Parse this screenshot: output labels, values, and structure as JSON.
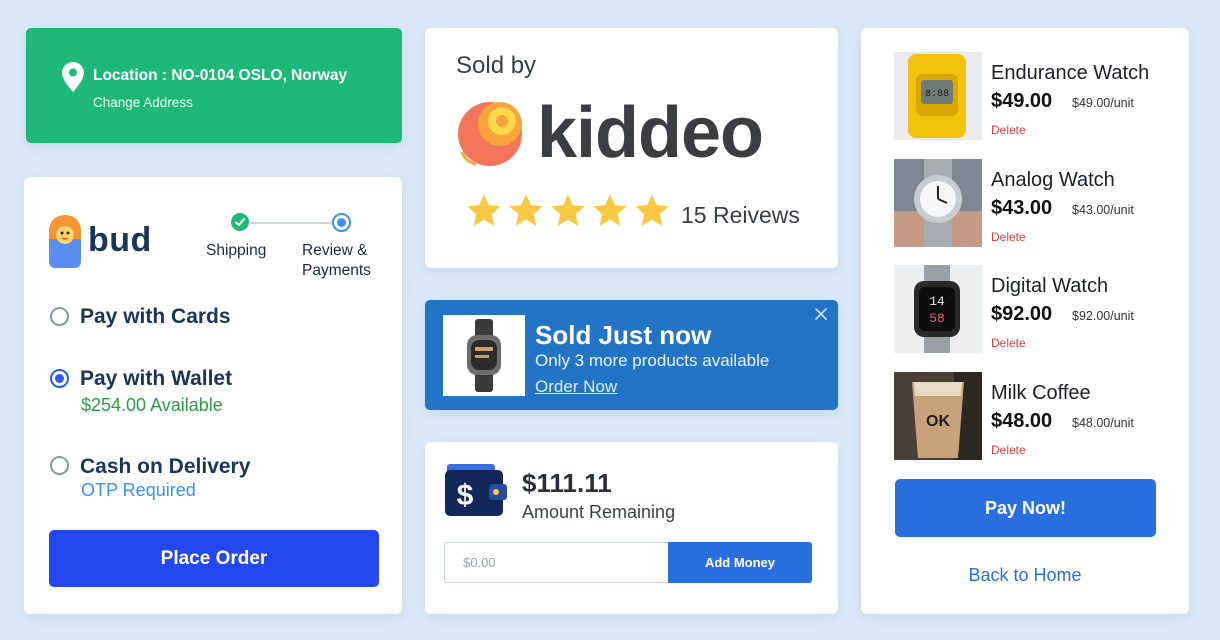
{
  "colors": {
    "background": "#dbe9f7",
    "location_green": "#1eb878",
    "primary_blue": "#2447f0",
    "accent_blue": "#2a6fe0",
    "banner_blue": "#2374c6",
    "wallet_green": "#2e9a48",
    "otp_blue": "#3b8ff0",
    "delete_red": "#e03a3a",
    "star_gold": "#f7c843"
  },
  "location": {
    "icon": "map-pin-icon",
    "title": "Location : NO-0104 OSLO, Norway",
    "change_label": "Change Address"
  },
  "checkout": {
    "brand": "bud",
    "steps": [
      {
        "label": "Shipping",
        "state": "done"
      },
      {
        "label": "Review & Payments",
        "state": "active"
      }
    ],
    "payment_options": [
      {
        "label": "Pay with Cards",
        "sub": "",
        "selected": false
      },
      {
        "label": "Pay with Wallet",
        "sub": "$254.00 Available",
        "selected": true
      },
      {
        "label": "Cash on Delivery",
        "sub": "OTP Required",
        "selected": false
      }
    ],
    "place_order_label": "Place Order"
  },
  "seller": {
    "sold_by_label": "Sold by",
    "brand": "kiddeo",
    "rating": 5,
    "reviews_label": "15 Reivews"
  },
  "notification": {
    "title": "Sold Just now",
    "message": "Only 3 more products available",
    "link_label": "Order Now",
    "close_icon": "close-icon"
  },
  "wallet": {
    "amount": "$111.11",
    "label": "Amount Remaining",
    "input_placeholder": "$0.00",
    "button_label": "Add Money"
  },
  "cart": {
    "items": [
      {
        "name": "Endurance Watch",
        "price": "$49.00",
        "unit_price": "$49.00/unit",
        "delete_label": "Delete"
      },
      {
        "name": "Analog Watch",
        "price": "$43.00",
        "unit_price": "$43.00/unit",
        "delete_label": "Delete"
      },
      {
        "name": "Digital Watch",
        "price": "$92.00",
        "unit_price": "$92.00/unit",
        "delete_label": "Delete"
      },
      {
        "name": "Milk Coffee",
        "price": "$48.00",
        "unit_price": "$48.00/unit",
        "delete_label": "Delete"
      }
    ],
    "pay_now_label": "Pay Now!",
    "back_label": "Back to Home"
  }
}
